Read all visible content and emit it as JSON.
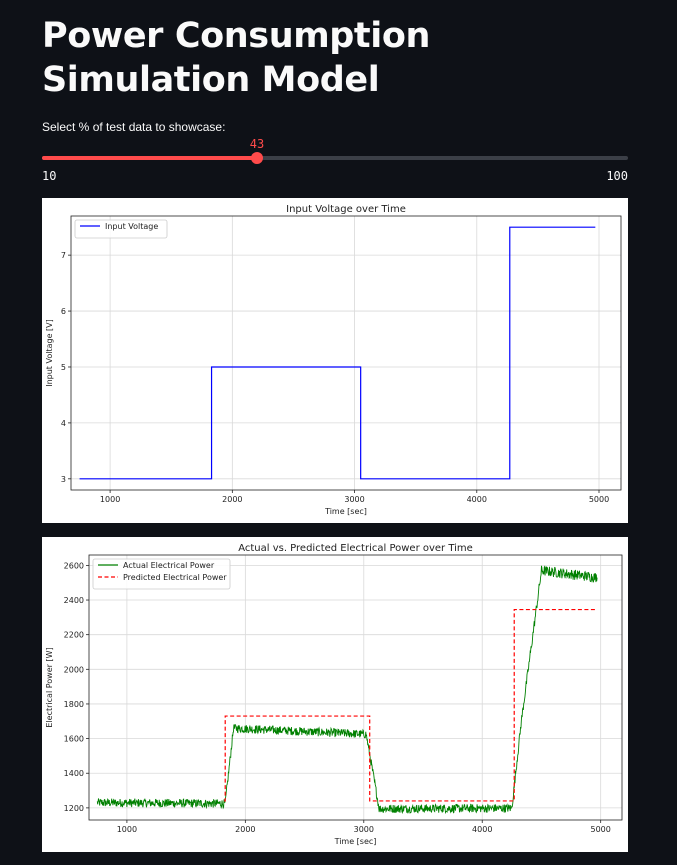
{
  "page": {
    "title": "Power Consumption Simulation Model"
  },
  "slider": {
    "label": "Select % of test data to showcase:",
    "value": 43,
    "min": 10,
    "max": 100,
    "accent_color": "#ff4b4b",
    "track_color": "#3b3f47"
  },
  "chart_data": [
    {
      "type": "line",
      "title": "Input Voltage over Time",
      "xlabel": "Time [sec]",
      "ylabel": "Input Voltage [V]",
      "xlim": [
        680,
        5180
      ],
      "ylim": [
        2.8,
        7.7
      ],
      "xticks": [
        1000,
        2000,
        3000,
        4000,
        5000
      ],
      "yticks": [
        3,
        4,
        5,
        6,
        7
      ],
      "grid": true,
      "legend_position": "top-left",
      "series": [
        {
          "name": "Input Voltage",
          "color": "#0000ff",
          "style": "solid",
          "x": [
            750,
            1830,
            1830,
            3050,
            3050,
            4270,
            4270,
            4970
          ],
          "y": [
            3,
            3,
            5,
            5,
            3,
            3,
            7.5,
            7.5
          ]
        }
      ]
    },
    {
      "type": "line",
      "title": "Actual vs. Predicted Electrical Power over Time",
      "xlabel": "Time [sec]",
      "ylabel": "Electrical Power [W]",
      "xlim": [
        680,
        5180
      ],
      "ylim": [
        1130,
        2660
      ],
      "xticks": [
        1000,
        2000,
        3000,
        4000,
        5000
      ],
      "yticks": [
        1200,
        1400,
        1600,
        1800,
        2000,
        2200,
        2400,
        2600
      ],
      "grid": true,
      "legend_position": "top-left",
      "series": [
        {
          "name": "Actual Electrical Power",
          "color": "#008000",
          "style": "solid",
          "x": [
            750,
            1830,
            1900,
            3020,
            3130,
            4250,
            4330,
            4500,
            4970
          ],
          "y": [
            1230,
            1225,
            1660,
            1625,
            1195,
            1198,
            1700,
            2570,
            2530
          ],
          "noise_amplitude": [
            25,
            25,
            25,
            25,
            25,
            25,
            25,
            30,
            30
          ]
        },
        {
          "name": "Predicted Electrical Power",
          "color": "#ff0000",
          "style": "dashed",
          "x": [
            1820,
            1830,
            1830,
            3050,
            3050,
            4270,
            4270,
            4970
          ],
          "y": [
            1240,
            1240,
            1730,
            1730,
            1240,
            1240,
            2345,
            2345
          ]
        }
      ]
    }
  ]
}
